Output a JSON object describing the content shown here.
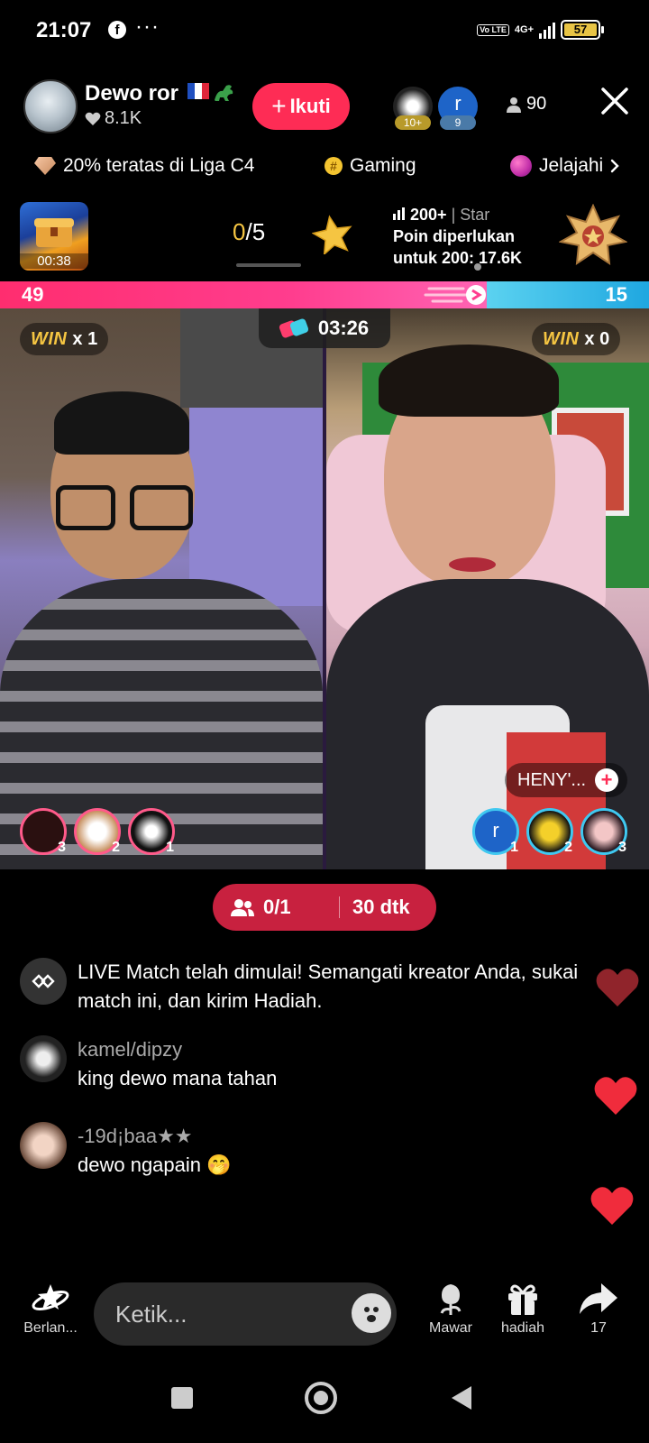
{
  "status_bar": {
    "time": "21:07",
    "facebook_glyph": "f",
    "more": "···",
    "volte": "Vo LTE",
    "network": "4G+",
    "battery": "57"
  },
  "host": {
    "name": "Dewo ror",
    "likes": "8.1K",
    "follow_label": "Ikuti",
    "viewer_count": "90",
    "top_viewers": [
      {
        "badge": "10+"
      },
      {
        "initial": "r",
        "badge": "9"
      }
    ]
  },
  "chips": {
    "league": "20% teratas di Liga C4",
    "category": "Gaming",
    "explore": "Jelajahi"
  },
  "match_info": {
    "thumb_time": "00:38",
    "progress_done": "0",
    "progress_total": "/5",
    "rank_points": "200+",
    "rank_star": "| Star",
    "rank_line2": "Poin diperlukan",
    "rank_line3": "untuk 200: 17.6K"
  },
  "score": {
    "left": "49",
    "right": "15",
    "left_fraction": 0.75
  },
  "battle": {
    "timer": "03:26",
    "left_win_label": "WIN",
    "left_win_count": "x 1",
    "right_win_label": "WIN",
    "right_win_count": "x 0",
    "guest_name": "HENY'...",
    "left_supporters": [
      {
        "rank": "3"
      },
      {
        "rank": "2"
      },
      {
        "rank": "1"
      }
    ],
    "right_supporters": [
      {
        "initial": "r",
        "rank": "1"
      },
      {
        "rank": "2"
      },
      {
        "rank": "3"
      }
    ]
  },
  "team": {
    "members": "0/1",
    "time": "30 dtk"
  },
  "chat": [
    {
      "user": "",
      "text": "LIVE Match telah dimulai! Semangati kreator Anda, sukai match ini, dan kirim Hadiah."
    },
    {
      "user": "kamel/dipzy",
      "text": "king dewo mana tahan"
    },
    {
      "user": "-19d¡baa★★",
      "text": "dewo ngapain 🤭"
    }
  ],
  "bottom": {
    "explore_label": "Berlan...",
    "comment_placeholder": "Ketik...",
    "rose_label": "Mawar",
    "gift_label": "hadiah",
    "share_count": "17"
  },
  "colors": {
    "accent": "#fe2c55",
    "win_gold": "#f5c542",
    "score_blue": "#1fa7e0",
    "team_pill": "#c8213f"
  }
}
